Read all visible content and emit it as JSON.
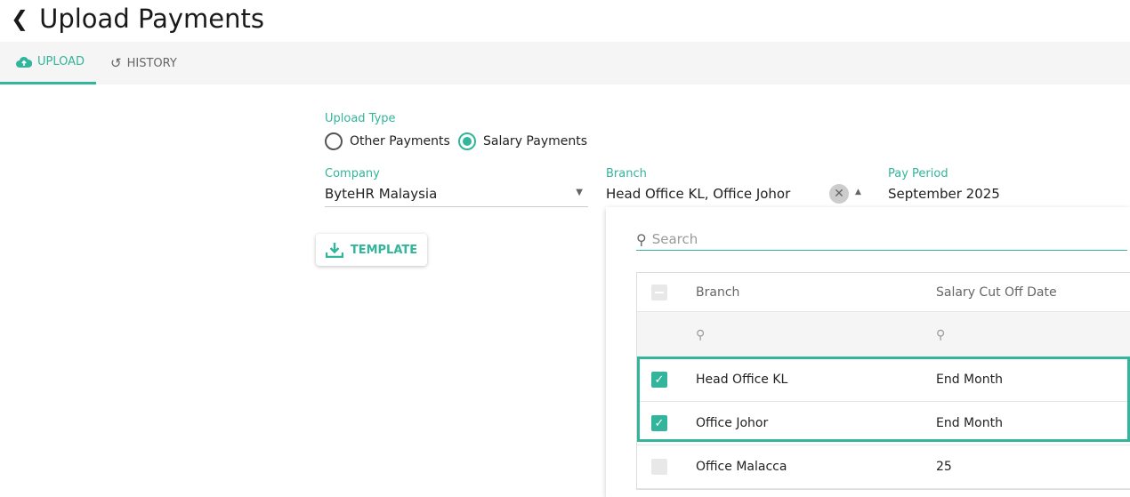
{
  "page": {
    "title": "Upload Payments"
  },
  "tabs": [
    {
      "label": "UPLOAD",
      "icon": "cloud-upload-icon"
    },
    {
      "label": "HISTORY",
      "icon": "history-icon"
    }
  ],
  "form": {
    "upload_type_label": "Upload Type",
    "upload_type_options": [
      "Other Payments",
      "Salary Payments"
    ],
    "upload_type_selected": "Salary Payments",
    "company_label": "Company",
    "company_value": "ByteHR Malaysia",
    "branch_label": "Branch",
    "branch_value": "Head Office KL, Office Johor",
    "pay_period_label": "Pay Period",
    "pay_period_value": "September 2025",
    "template_button": "TEMPLATE"
  },
  "dropdown": {
    "search_placeholder": "Search",
    "columns": [
      "Branch",
      "Salary Cut Off Date"
    ],
    "rows": [
      {
        "branch": "Head Office KL",
        "cutoff": "End Month",
        "checked": true
      },
      {
        "branch": "Office Johor",
        "cutoff": "End Month",
        "checked": true
      },
      {
        "branch": "Office Malacca",
        "cutoff": "25",
        "checked": false
      }
    ]
  },
  "colors": {
    "accent": "#33b59b"
  }
}
